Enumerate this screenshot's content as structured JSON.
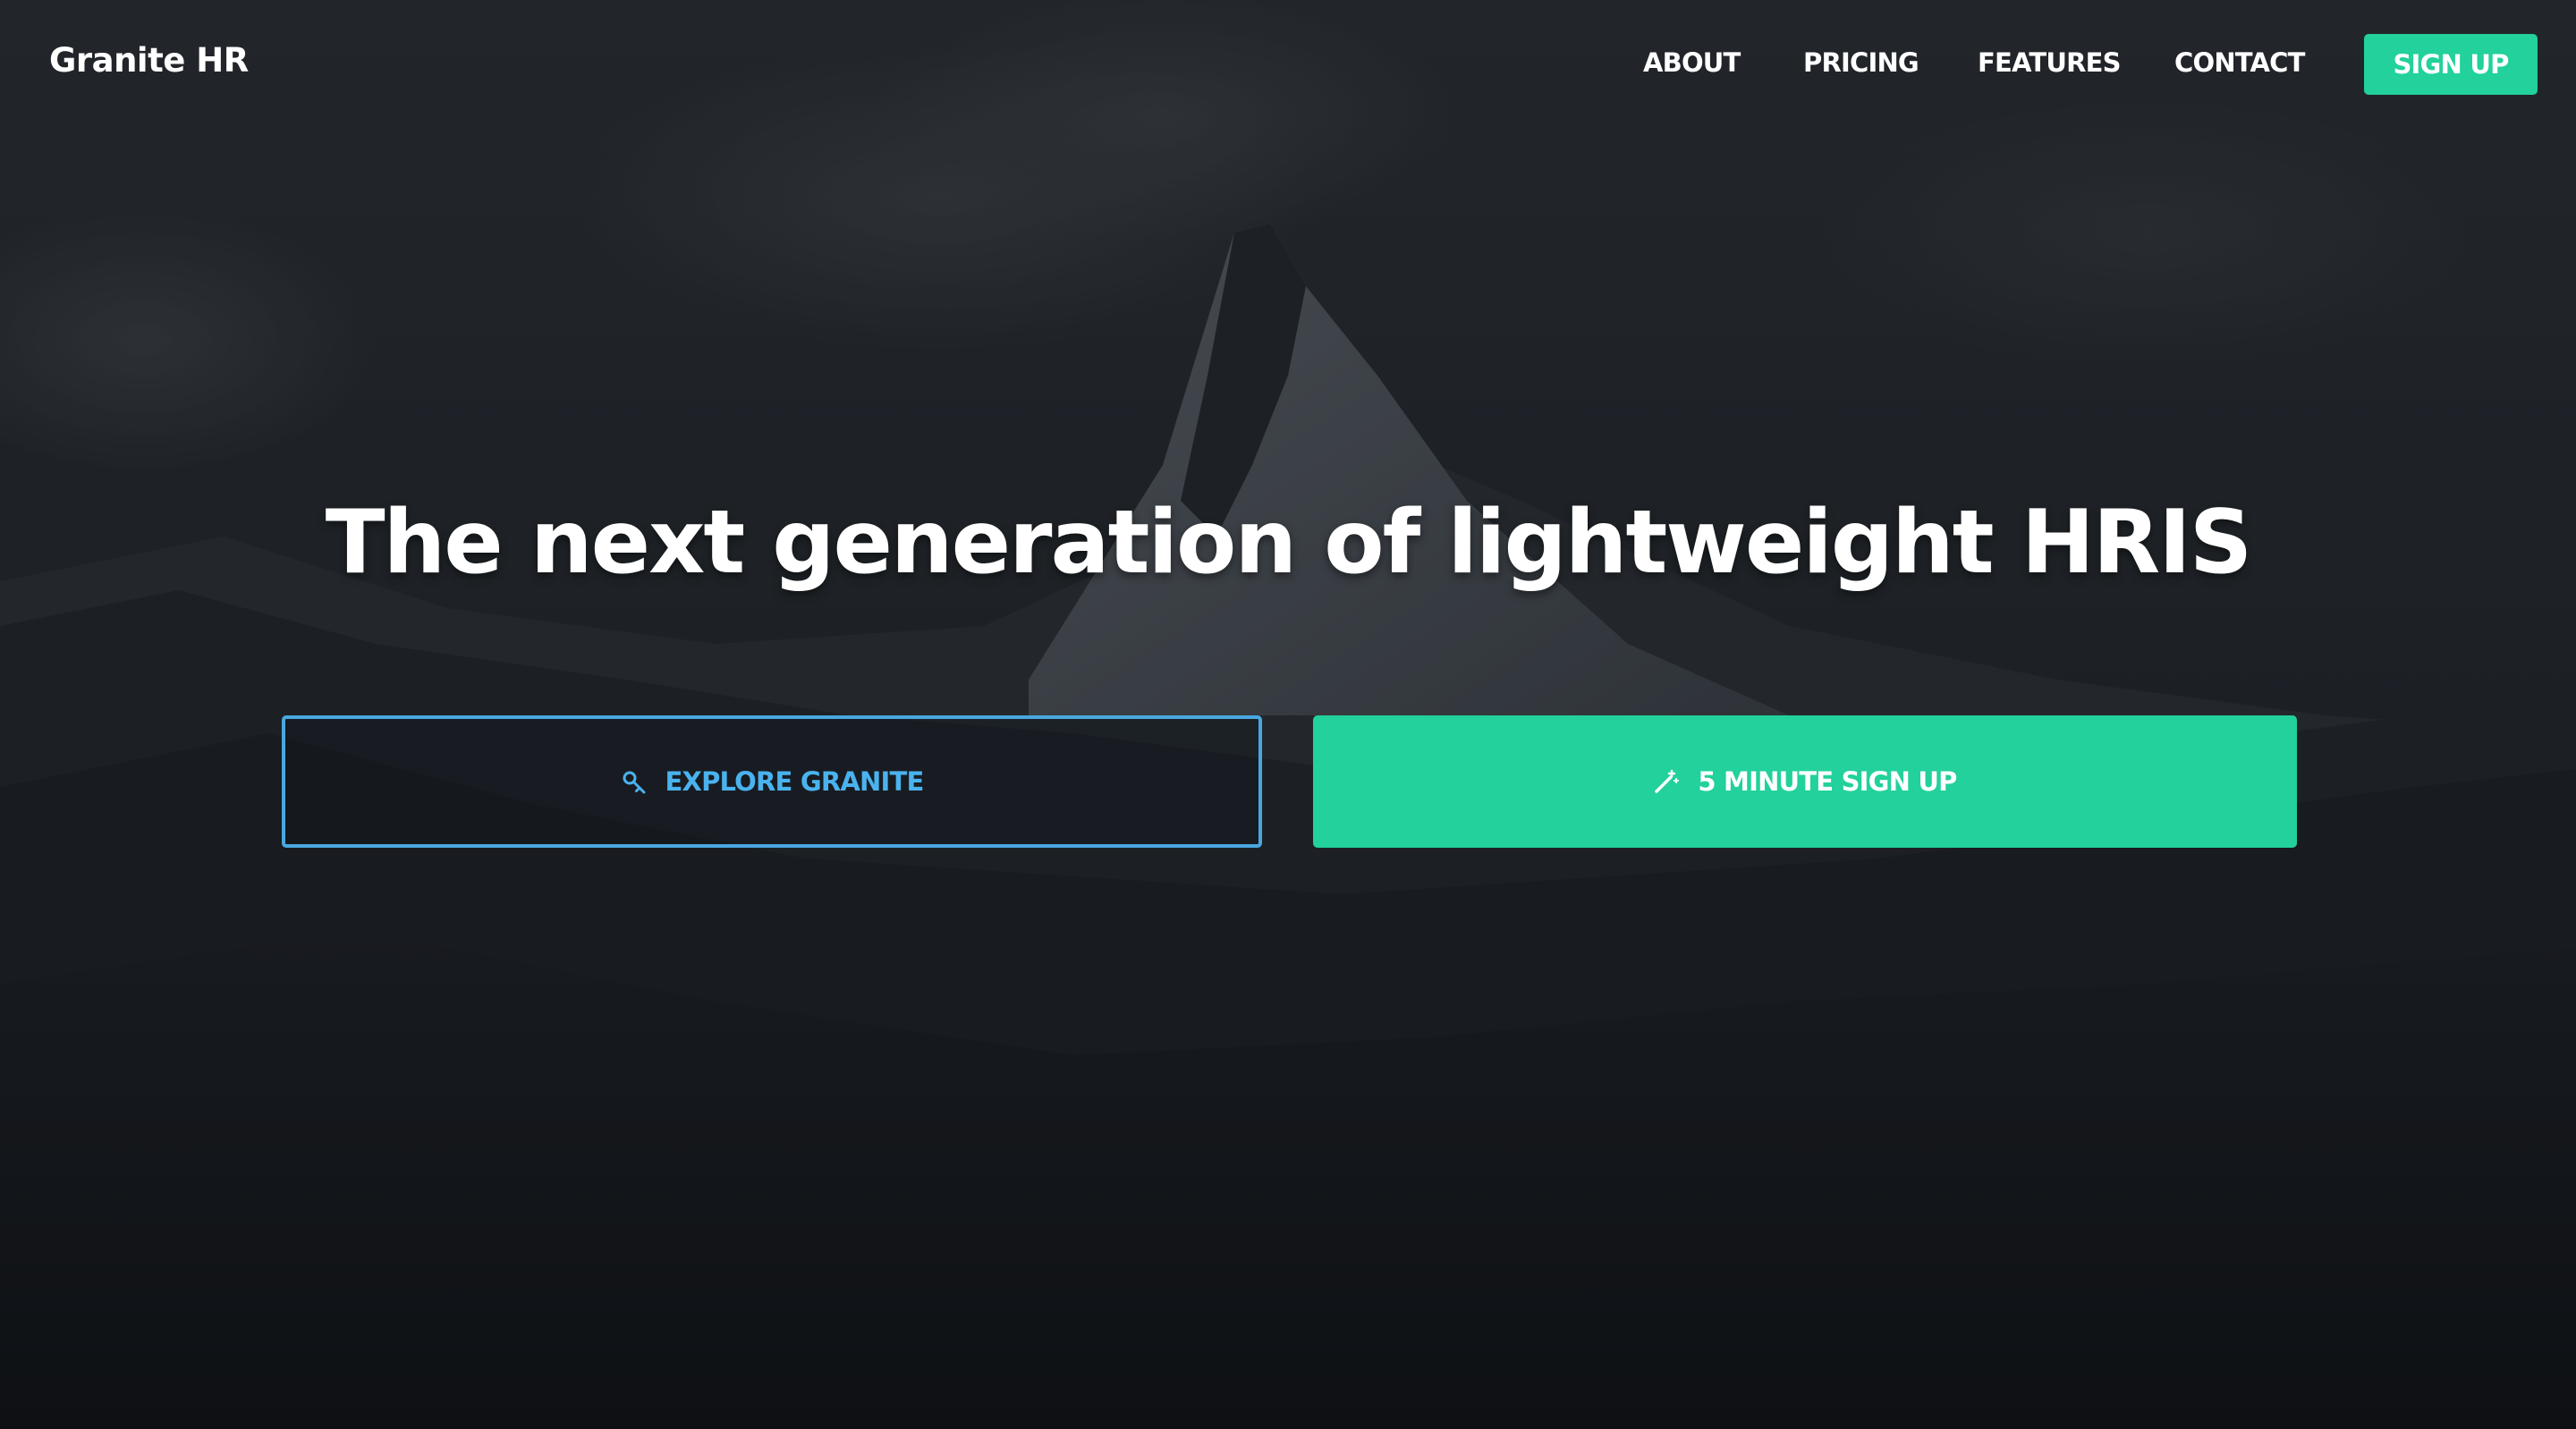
{
  "brand": {
    "name": "Granite HR"
  },
  "nav": {
    "items": [
      {
        "label": "ABOUT"
      },
      {
        "label": "PRICING"
      },
      {
        "label": "FEATURES"
      },
      {
        "label": "CONTACT"
      }
    ],
    "signup_label": "SIGN UP"
  },
  "hero": {
    "headline": "The next generation of lightweight HRIS",
    "background": "dark mountain landscape photo with overlay"
  },
  "cta": {
    "explore": {
      "label": "EXPLORE GRANITE",
      "icon": "key-icon"
    },
    "signup": {
      "label": "5 MINUTE SIGN UP",
      "icon": "magic-wand-icon"
    }
  },
  "colors": {
    "accent": "#22d19b",
    "outline": "#4aa8e0",
    "text": "#ffffff",
    "overlay": "#15181d"
  }
}
